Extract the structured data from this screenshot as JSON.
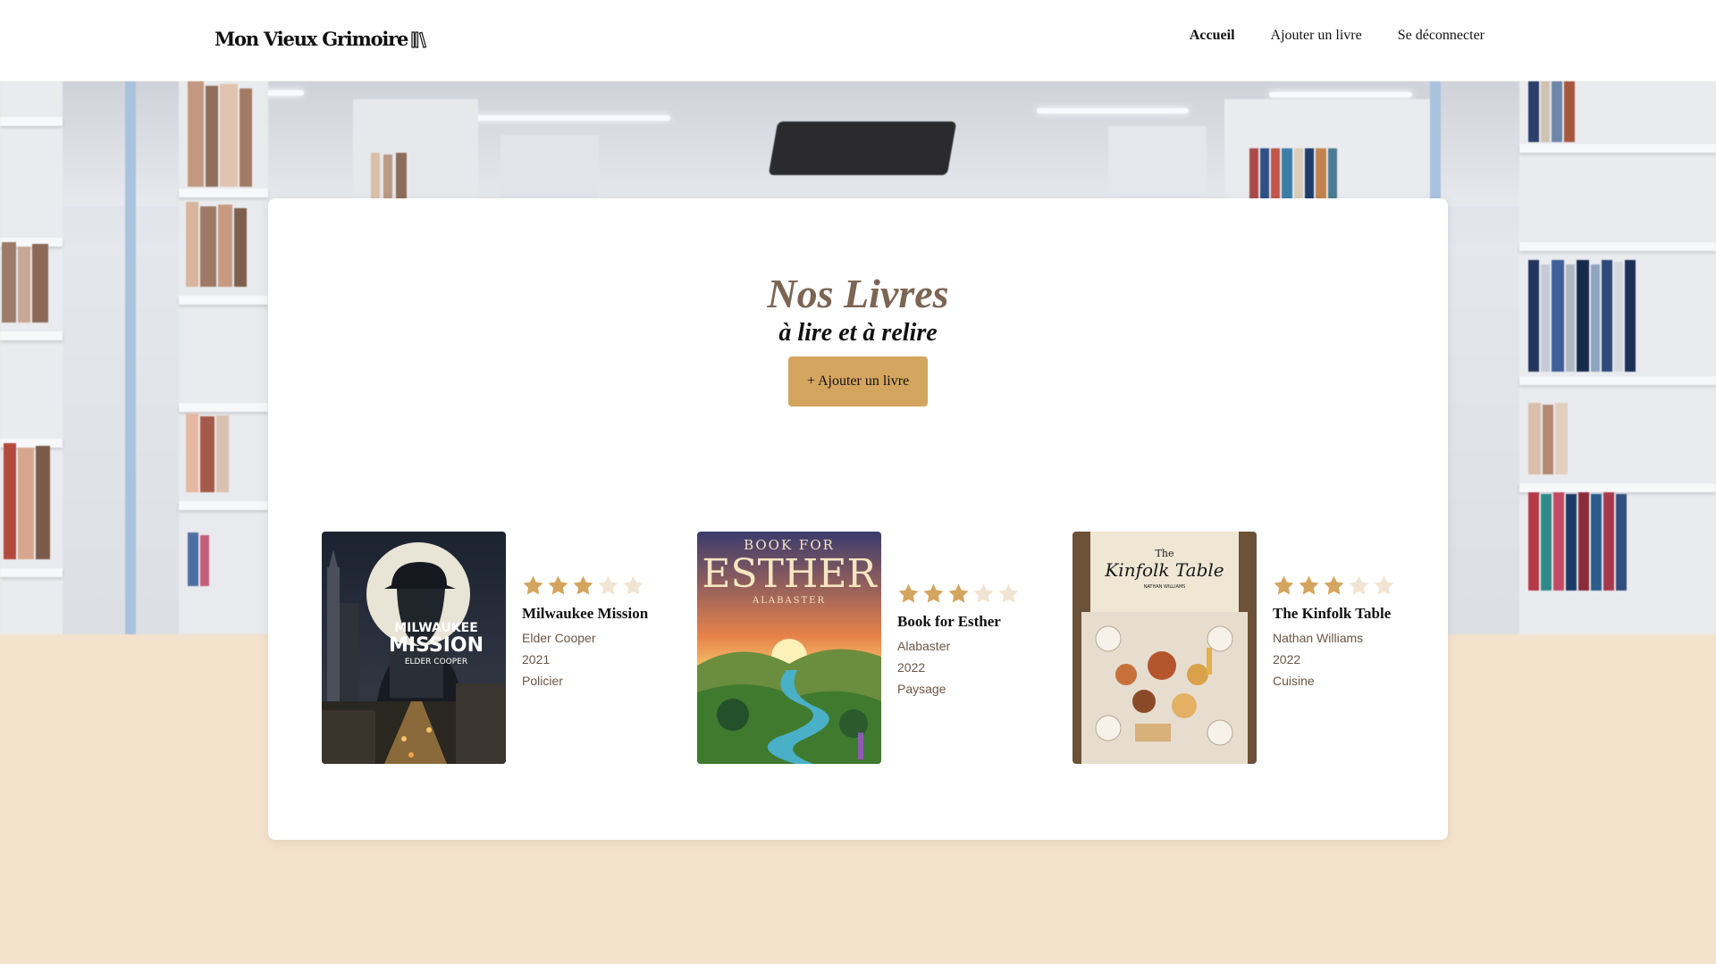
{
  "header": {
    "logo_text": "Mon Vieux Grimoire",
    "nav": [
      {
        "label": "Accueil",
        "active": true
      },
      {
        "label": "Ajouter un livre",
        "active": false
      },
      {
        "label": "Se déconnecter",
        "active": false
      }
    ]
  },
  "main": {
    "title": "Nos Livres",
    "subtitle": "à lire et à relire",
    "add_button_label": "+ Ajouter un livre",
    "books": [
      {
        "title": "Milwaukee Mission",
        "author": "Elder Cooper",
        "year": "2021",
        "genre": "Policier",
        "rating": 3,
        "max_rating": 5,
        "cover_text": [
          "MILWAUKEE",
          "MISSION",
          "ELDER COOPER"
        ]
      },
      {
        "title": "Book for Esther",
        "author": "Alabaster",
        "year": "2022",
        "genre": "Paysage",
        "rating": 3,
        "max_rating": 5,
        "cover_text": [
          "BOOK FOR",
          "ESTHER",
          "ALABASTER"
        ]
      },
      {
        "title": "The Kinfolk Table",
        "author": "Nathan Williams",
        "year": "2022",
        "genre": "Cuisine",
        "rating": 3,
        "max_rating": 5,
        "cover_text": [
          "The",
          "Kinfolk Table",
          "NATHAN WILLIAMS"
        ]
      }
    ]
  },
  "colors": {
    "accent": "#d4a55e",
    "title": "#7b6553",
    "page_bg": "#f3e2cc",
    "star_filled": "#d4a55e",
    "star_empty": "#f1e4d2"
  }
}
